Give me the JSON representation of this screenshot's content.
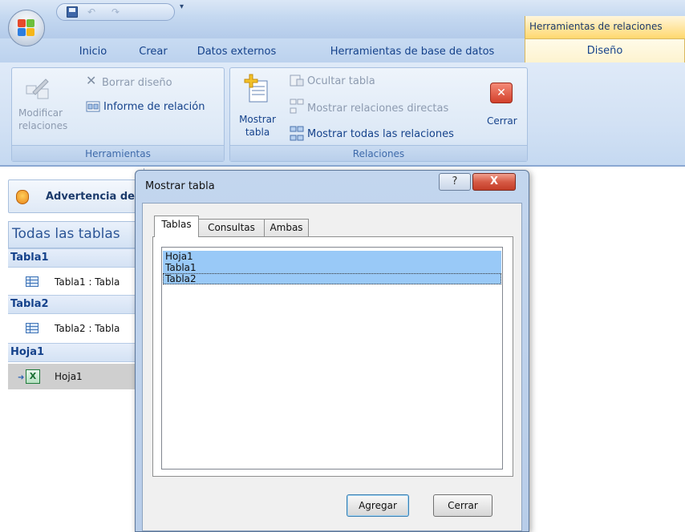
{
  "titlebar": {
    "context_title": "Herramientas de relaciones",
    "quick_access": {
      "icons": [
        "save-icon",
        "undo-icon",
        "redo-icon",
        "customize-dropdown-icon"
      ]
    }
  },
  "ribbon_tabs": {
    "inicio": "Inicio",
    "crear": "Crear",
    "datos_externos": "Datos externos",
    "herramientas_bd": "Herramientas de base de datos",
    "diseno": "Diseño"
  },
  "ribbon": {
    "herramientas": {
      "label": "Herramientas",
      "modificar_line1": "Modificar",
      "modificar_line2": "relaciones",
      "borrar_diseno": "Borrar diseño",
      "informe_relacion": "Informe de relación"
    },
    "relaciones": {
      "label": "Relaciones",
      "mostrar_line1": "Mostrar",
      "mostrar_line2": "tabla",
      "ocultar_tabla": "Ocultar tabla",
      "mostrar_directas": "Mostrar relaciones directas",
      "mostrar_todas": "Mostrar todas las relaciones",
      "cerrar": "Cerrar"
    }
  },
  "nav_pane": {
    "warning": "Advertencia de",
    "header": "Todas las tablas",
    "groups": [
      {
        "name": "Tabla1",
        "item": "Tabla1 : Tabla"
      },
      {
        "name": "Tabla2",
        "item": "Tabla2 : Tabla"
      },
      {
        "name": "Hoja1",
        "item": "Hoja1"
      }
    ]
  },
  "dialog": {
    "title": "Mostrar tabla",
    "help_glyph": "?",
    "close_glyph": "X",
    "tabs": [
      "Tablas",
      "Consultas",
      "Ambas"
    ],
    "active_tab": "Tablas",
    "list_items": [
      "Hoja1",
      "Tabla1",
      "Tabla2"
    ],
    "buttons": {
      "agregar": "Agregar",
      "cerrar": "Cerrar"
    }
  },
  "colors": {
    "ribbon_text": "#15428b",
    "context_tab": "#ffd86e",
    "list_selection": "#99c9f7",
    "close_red": "#c43d27"
  }
}
